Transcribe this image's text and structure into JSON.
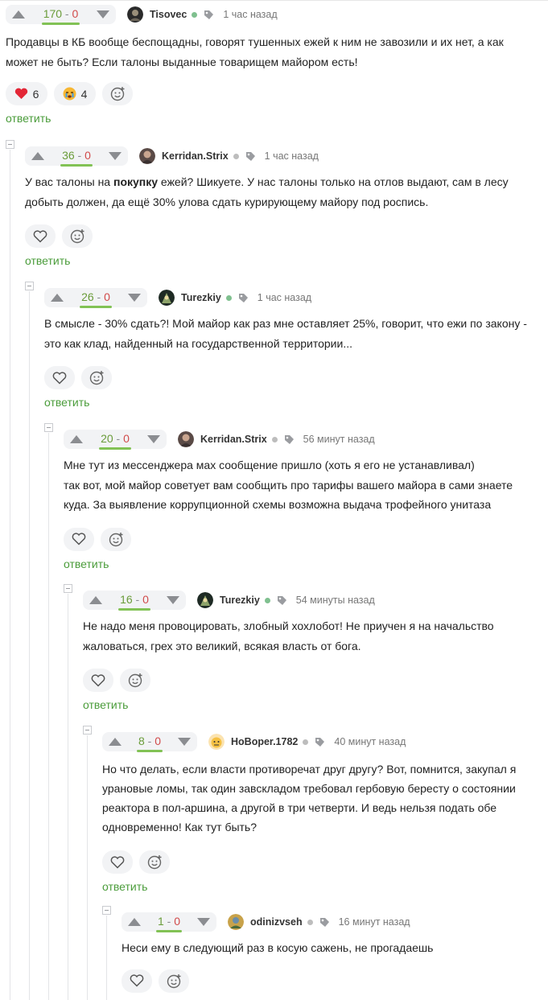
{
  "reply_label": "ответить",
  "comments": [
    {
      "plus": "170",
      "sep": " - ",
      "minus": "0",
      "author": "Tisovec",
      "online": true,
      "time": "1 час назад",
      "text": "Продавцы в КБ вообще беспощадны, говорят тушенных ежей к ним не завозили и их нет, а как может не быть? Если талоны выданные товарищем майором есть!",
      "reactions": [
        {
          "icon": "heart-icon",
          "count": "6"
        },
        {
          "icon": "crying-face-icon",
          "count": "4"
        }
      ]
    },
    {
      "plus": "36",
      "sep": " - ",
      "minus": "0",
      "author": "Kerridan.Strix",
      "online": false,
      "time": "1 час назад",
      "text_before": "У вас талоны на ",
      "text_bold": "покупку",
      "text_after": " ежей? Шикуете. У нас талоны только на отлов выдают, сам в лесу добыть должен, да ещё 30% улова сдать курирующему майору под роспись."
    },
    {
      "plus": "26",
      "sep": " - ",
      "minus": "0",
      "author": "Turezkiy",
      "online": true,
      "time": "1 час назад",
      "text": "В смысле - 30% сдать?! Мой майор как раз мне оставляет 25%, говорит, что ежи по закону - это как клад, найденный на государственной территории..."
    },
    {
      "plus": "20",
      "sep": " - ",
      "minus": "0",
      "author": "Kerridan.Strix",
      "online": false,
      "time": "56 минут назад",
      "text_line1": "Мне тут из мессенджера мах сообщение пришло (хоть я его не устанавливал)",
      "text_line2": "так вот, мой майор советует вам сообщить про тарифы вашего майора в сами знаете куда. За выявление коррупционной схемы возможна выдача трофейного унитаза"
    },
    {
      "plus": "16",
      "sep": " - ",
      "minus": "0",
      "author": "Turezkiy",
      "online": true,
      "time": "54 минуты назад",
      "text": "Не надо меня провоцировать, злобный хохлобот! Не приучен я на начальство жаловаться, грех это великий, всякая власть от бога."
    },
    {
      "plus": "8",
      "sep": " - ",
      "minus": "0",
      "author": "HoBoper.1782",
      "online": false,
      "time": "40 минут назад",
      "text": "Но что делать, если власти противоречат друг другу? Вот, помнится, закупал я урановые ломы, так один завскладом требовал гербовую бересту о состоянии реактора в пол-аршина, а другой в три четверти. И ведь нельзя подать обе одновременно! Как тут быть?"
    },
    {
      "plus": "1",
      "sep": " - ",
      "minus": "0",
      "author": "odinizvseh",
      "online": false,
      "time": "16 минут назад",
      "text": "Неси ему в следующий раз в косую сажень, не прогадаешь"
    }
  ],
  "colors": {
    "online": "#7fc08f",
    "offline": "#bdbdbd",
    "reply": "#4a9c3a",
    "plus": "#6a9c3a",
    "minus": "#d14a4a"
  }
}
